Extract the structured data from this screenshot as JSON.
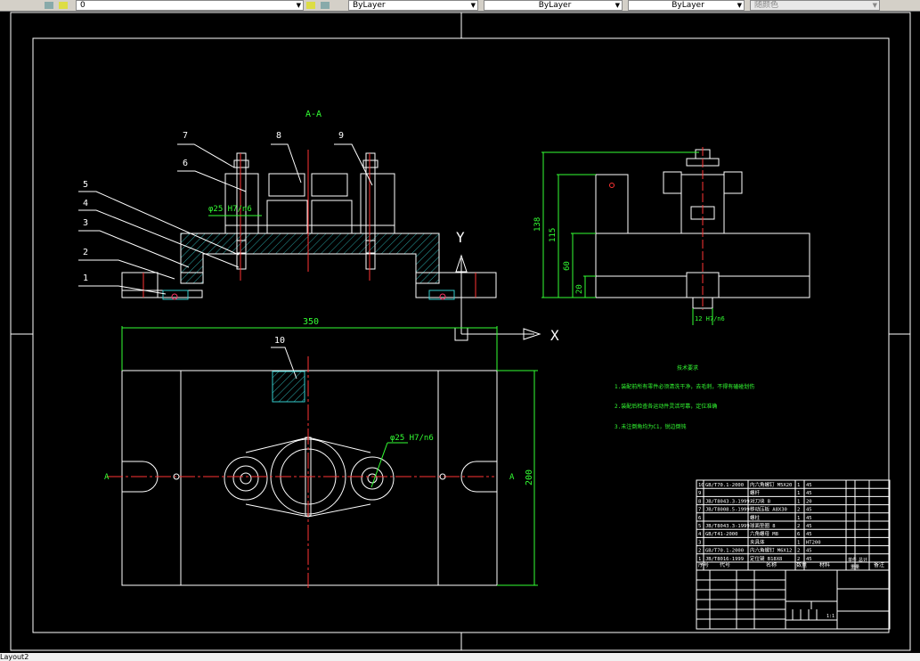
{
  "toolbar": {
    "layer_value": "0",
    "color_value": "ByLayer",
    "linetype_value": "ByLayer",
    "lineweight_value": "ByLayer",
    "plotstyle_value": "随颜色"
  },
  "drawing": {
    "section_label": "A-A",
    "part_numbers": [
      "1",
      "2",
      "3",
      "4",
      "5",
      "6",
      "7",
      "8",
      "9",
      "10"
    ],
    "fit_label": "φ25 H7/n6",
    "axis_x": "X",
    "axis_y": "Y",
    "section_mark_left": "A",
    "section_mark_right": "A",
    "dim_width": "350",
    "dim_depth": "200",
    "dim_138": "138",
    "dim_115": "115",
    "dim_60": "60",
    "dim_20": "20",
    "dim_bottom": "12 H7/n6"
  },
  "notes": {
    "title": "技术要求",
    "lines": [
      "1.装配前所有零件必须清洗干净，去毛刺，不得有磕碰划伤",
      "2.装配后检查各运动件灵活可靠，定位准确",
      "3.未注倒角均为C1，锐边倒钝"
    ]
  },
  "bom": {
    "rows": [
      {
        "no": "10",
        "code": "GB/T70.1-2000",
        "name": "内六角螺钉 M5X20",
        "qty": "1",
        "mat": "45"
      },
      {
        "no": "9",
        "code": "",
        "name": "螺杆",
        "qty": "1",
        "mat": "45"
      },
      {
        "no": "8",
        "code": "JB/T8043.3-1999",
        "name": "对刀块 B",
        "qty": "1",
        "mat": "20"
      },
      {
        "no": "7",
        "code": "JB/T8008.5-1999",
        "name": "移动压板 A8X30",
        "qty": "2",
        "mat": "45"
      },
      {
        "no": "6",
        "code": "",
        "name": "螺柱",
        "qty": "1",
        "mat": "45"
      },
      {
        "no": "5",
        "code": "JB/T8043.3-1999",
        "name": "球面垫圈 8",
        "qty": "2",
        "mat": "45"
      },
      {
        "no": "4",
        "code": "GB/T41-2000",
        "name": "六角螺母 M8",
        "qty": "6",
        "mat": "45"
      },
      {
        "no": "3",
        "code": "",
        "name": "夹具体",
        "qty": "1",
        "mat": "HT200"
      },
      {
        "no": "2",
        "code": "GB/T70.1-2000",
        "name": "内六角螺钉 M6X12",
        "qty": "2",
        "mat": "45"
      },
      {
        "no": "1",
        "code": "JB/T8016-1999",
        "name": "定位键 B18X8",
        "qty": "2",
        "mat": "45"
      }
    ],
    "headers": {
      "no": "序号",
      "code": "代号",
      "name": "名称",
      "qty": "数量",
      "mat": "材料",
      "unit": "单件",
      "total": "总计",
      "weight": "重量",
      "remark": "备注"
    },
    "scale": "1:1"
  },
  "status": {
    "command": "Layout2"
  }
}
